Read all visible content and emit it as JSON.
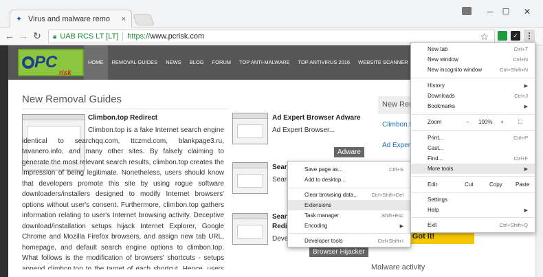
{
  "window": {
    "tab_title": "Virus and malware remo",
    "tab_close": "×",
    "controls": {
      "minimize": "─",
      "maximize": "☐",
      "close": "✕"
    }
  },
  "toolbar": {
    "back": "←",
    "forward": "→",
    "reload": "↻",
    "secure_label": "UAB RCS LT [LT]",
    "url_scheme": "https://",
    "url_host": "www.pcrisk.com",
    "bookmark": "☆",
    "menu": "⋮"
  },
  "site": {
    "logo_text": "PC",
    "logo_suffix": "risk",
    "nav": [
      "HOME",
      "REMOVAL GUIDES",
      "NEWS",
      "BLOG",
      "FORUM",
      "TOP ANTI-MALWARE",
      "TOP ANTIVIRUS 2016",
      "WEBSITE SCANNER"
    ],
    "section_title": "New Removal Guides",
    "article1": {
      "title": "Climbon.top Redirect",
      "body": "Climbon.top is a fake Internet search engine identical to searchqq.com, ttczmd.com, blankpage3.ru, tavanero.info, and many other sites. By falsely claiming to generate the most relevant search results, climbon.top creates the impression of being legitimate. Nonetheless, users should know that developers promote this site by using rogue software downloaders/installers designed to modify Internet browsers' options without user's consent. Furthermore, climbon.top gathers information relating to user's Internet browsing activity. Deceptive download/installation setups hijack Internet Explorer, Google Chrome and Mozilla Firefox browsers, and assign new tab URL, homepage, and default search engine options to climbon.top. What follows is the modification of browsers' shortcuts - setups append climbon.top to the target of each shortcut. Hence, users are automatically redirected to"
    },
    "article2": {
      "title": "Ad Expert Browser Adware",
      "body": "Ad Expert Browser...",
      "tag": "Adware"
    },
    "article3": {
      "title": "Searc",
      "body": "Searc"
    },
    "article4": {
      "title": "Searc",
      "title2": "Redir",
      "body": "Deve",
      "tag": "Browser Hijacker"
    },
    "sidebar_title": "New Rem",
    "sidebar_links": [
      "Climbon.to",
      "Ad Expert"
    ],
    "malware_title": "Malware activity",
    "gotit": "Got it!"
  },
  "chrome_menu": {
    "new_tab": "New tab",
    "new_tab_sc": "Ctrl+T",
    "new_window": "New window",
    "new_window_sc": "Ctrl+N",
    "incognito": "New incognito window",
    "incognito_sc": "Ctrl+Shift+N",
    "history": "History",
    "downloads": "Downloads",
    "downloads_sc": "Ctrl+J",
    "bookmarks": "Bookmarks",
    "zoom": "Zoom",
    "zoom_minus": "−",
    "zoom_value": "100%",
    "zoom_plus": "+",
    "fullscreen": "⛶",
    "print": "Print...",
    "print_sc": "Ctrl+P",
    "cast": "Cast...",
    "find": "Find...",
    "find_sc": "Ctrl+F",
    "more_tools": "More tools",
    "edit": "Edit",
    "cut": "Cut",
    "copy": "Copy",
    "paste": "Paste",
    "settings": "Settings",
    "help": "Help",
    "exit": "Exit",
    "exit_sc": "Ctrl+Shift+Q"
  },
  "more_tools_menu": {
    "save_page": "Save page as...",
    "save_page_sc": "Ctrl+S",
    "add_desktop": "Add to desktop...",
    "clear_data": "Clear browsing data...",
    "clear_data_sc": "Ctrl+Shift+Del",
    "extensions": "Extensions",
    "task_manager": "Task manager",
    "task_manager_sc": "Shift+Esc",
    "encoding": "Encoding",
    "dev_tools": "Developer tools",
    "dev_tools_sc": "Ctrl+Shift+I"
  }
}
